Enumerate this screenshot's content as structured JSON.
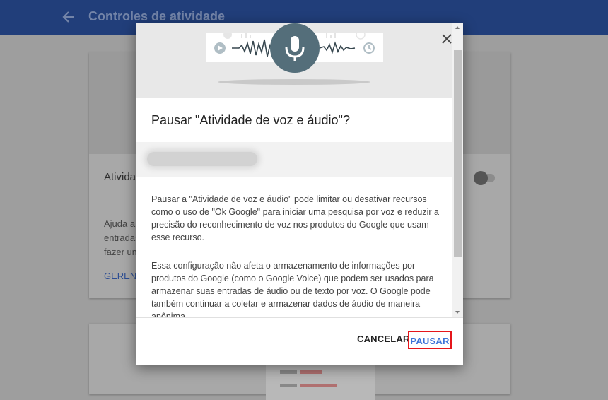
{
  "appbar": {
    "title": "Controles de atividade",
    "back_icon": "arrow-left-icon"
  },
  "background_card": {
    "row_title": "Atividade",
    "description_lines": [
      "Ajuda a",
      "entradas",
      "fazer um"
    ],
    "manage_label": "GERENC"
  },
  "dialog": {
    "title": "Pausar \"Atividade de voz e áudio\"?",
    "paragraph1_lines": [
      "Pausar a \"Atividade de voz e áudio\" pode limitar ou desativar recursos",
      "como o uso de \"Ok Google\" para iniciar uma pesquisa por voz e reduzir a",
      "precisão do reconhecimento de voz nos produtos do Google que usam",
      "esse recurso."
    ],
    "paragraph2_lines": [
      "Essa configuração não afeta o armazenamento de informações por",
      "produtos do Google (como o Google Voice) que podem ser usados para",
      "armazenar suas entradas de áudio ou de texto por voz. O Google pode",
      "também continuar a coletar e armazenar dados de áudio de maneira",
      "anônima."
    ],
    "close_icon": "close-icon",
    "cancel_label": "CANCELAR",
    "pause_label": "PAUSAR"
  },
  "colors": {
    "appbar": "#213e7a",
    "mic": "#546e7a",
    "accent": "#3b73d8",
    "highlight": "#e5161b"
  }
}
